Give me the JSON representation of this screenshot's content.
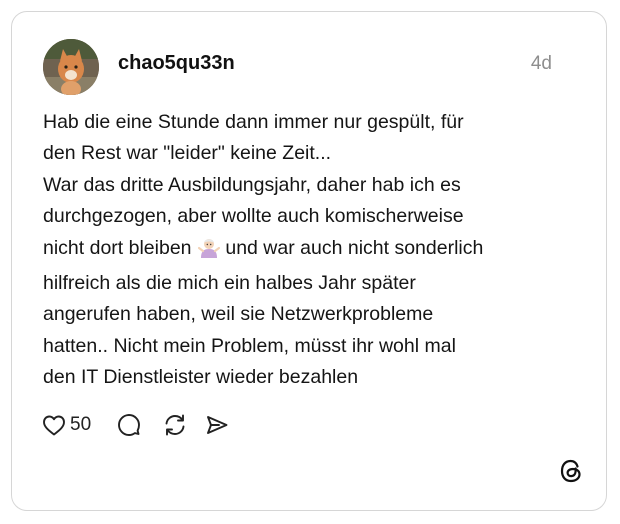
{
  "post": {
    "username": "chao5qu33n",
    "time": "4d",
    "text_before_emoji": "Hab die eine Stunde dann immer nur gespült, für\nden Rest war \"leider\" keine Zeit...\nWar das dritte Ausbildungsjahr, daher hab ich es\ndurchgezogen, aber wollte auch komischerweise\nnicht dort bleiben ",
    "emoji": "person-shrugging",
    "text_after_emoji": " und war auch nicht sonderlich\nhilfreich als die mich ein halbes Jahr später\nangerufen haben, weil sie Netzwerkprobleme\nhatten.. Nicht mein Problem, müsst ihr wohl mal\nden IT Dienstleister wieder bezahlen"
  },
  "actions": {
    "like_count": "50",
    "icons": [
      "heart-icon",
      "comment-icon",
      "repost-icon",
      "share-icon"
    ]
  },
  "brand": {
    "logo": "threads-logo-icon"
  },
  "colors": {
    "text": "#151515",
    "muted": "#8e8e8e",
    "border": "#d6d6d6"
  }
}
